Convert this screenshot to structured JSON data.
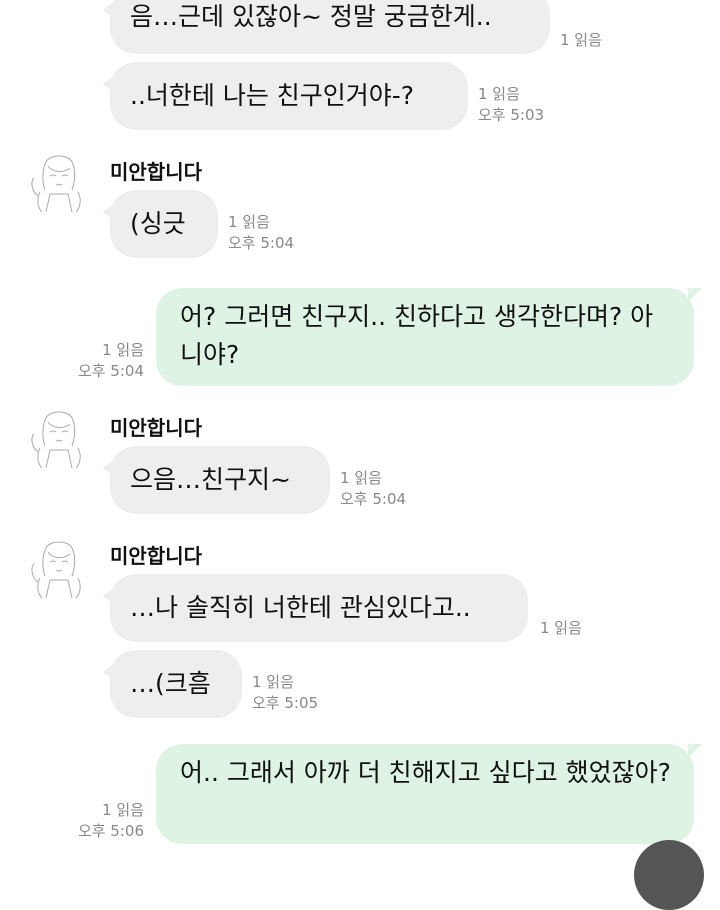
{
  "messages": [
    {
      "text": "음…근데 있잖아~ 정말 궁금한게..",
      "read": "1 읽음",
      "time": ""
    },
    {
      "text": "..너한테 나는 친구인거야-?",
      "read": "1 읽음",
      "time": "오후 5:03"
    },
    {
      "sender": "미안합니다",
      "text": "(싱긋",
      "read": "1 읽음",
      "time": "오후 5:04"
    },
    {
      "text": "어? 그러면 친구지.. 친하다고 생각한다며? 아니야?",
      "read": "1 읽음",
      "time": "오후 5:04"
    },
    {
      "sender": "미안합니다",
      "text": "으음…친구지~",
      "read": "1 읽음",
      "time": "오후 5:04"
    },
    {
      "sender": "미안합니다",
      "text": "…나 솔직히 너한테 관심있다고..",
      "read": "1 읽음",
      "time": ""
    },
    {
      "text": "…(크흠",
      "read": "1 읽음",
      "time": "오후 5:05"
    },
    {
      "text": "어.. 그래서 아까 더 친해지고 싶다고 했었잖아?",
      "read": "1 읽음",
      "time": "오후 5:06"
    }
  ],
  "colors": {
    "incoming": "#eeeeee",
    "outgoing": "#dff3e4",
    "meta": "#888888"
  },
  "icons": {
    "avatar": "avatar-sketch-icon"
  }
}
